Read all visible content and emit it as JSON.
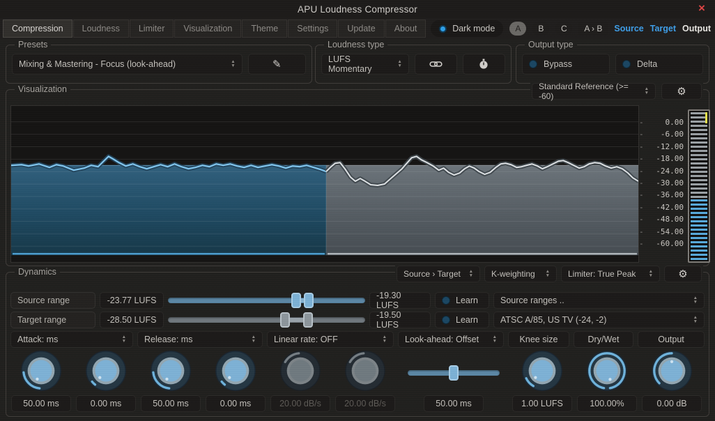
{
  "window": {
    "title": "APU Loudness Compressor"
  },
  "icons": {
    "close": "×",
    "edit": "✎",
    "gear": "⚙"
  },
  "tabs": [
    {
      "label": "Compression",
      "active": true
    },
    {
      "label": "Loudness"
    },
    {
      "label": "Limiter"
    },
    {
      "label": "Visualization"
    },
    {
      "label": "Theme"
    },
    {
      "label": "Settings"
    },
    {
      "label": "Update"
    },
    {
      "label": "About"
    }
  ],
  "topbar": {
    "dark_mode": "Dark mode",
    "variant_a": "A",
    "variant_b": "B",
    "variant_c": "C",
    "copy_ab": "A › B",
    "source": "Source",
    "target": "Target",
    "output": "Output"
  },
  "presets": {
    "legend": "Presets",
    "selected": "Mixing & Mastering - Focus (look-ahead)"
  },
  "loudness_type": {
    "legend": "Loudness type",
    "selected": "LUFS Momentary"
  },
  "output_type": {
    "legend": "Output type",
    "bypass": "Bypass",
    "delta": "Delta"
  },
  "visualization": {
    "legend": "Visualization",
    "reference": "Standard Reference (>= -60)",
    "scale_ticks": [
      "0.00",
      "-6.00",
      "-12.00",
      "-18.00",
      "-24.00",
      "-30.00",
      "-36.00",
      "-42.00",
      "-48.00",
      "-54.00",
      "-60.00"
    ]
  },
  "dynamics": {
    "legend": "Dynamics",
    "routing": "Source › Target",
    "weighting": "K-weighting",
    "limiter": "Limiter: True Peak",
    "source_range": {
      "label": "Source range",
      "low": "-23.77 LUFS",
      "high": "-19.30 LUFS",
      "learn": "Learn",
      "preset": "Source ranges .."
    },
    "target_range": {
      "label": "Target range",
      "low": "-28.50 LUFS",
      "high": "-19.50 LUFS",
      "learn": "Learn",
      "preset": "ATSC A/85, US TV (-24, -2)"
    },
    "param_headers": [
      {
        "label": "Attack: ms"
      },
      {
        "label": "Release: ms"
      },
      {
        "label": "Linear rate: OFF"
      },
      {
        "label": "Look-ahead: Offset"
      },
      {
        "label": "Knee size"
      },
      {
        "label": "Dry/Wet"
      },
      {
        "label": "Output"
      }
    ],
    "knobs": [
      {
        "id": "attack",
        "value": "50.00 ms"
      },
      {
        "id": "attack-secondary",
        "value": "0.00 ms"
      },
      {
        "id": "release",
        "value": "50.00 ms"
      },
      {
        "id": "release-secondary",
        "value": "0.00 ms"
      },
      {
        "id": "linear-rate-up",
        "value": "20.00 dB/s",
        "disabled": true
      },
      {
        "id": "linear-rate-down",
        "value": "20.00 dB/s",
        "disabled": true
      },
      {
        "id": "look-ahead",
        "value": "50.00 ms"
      },
      {
        "id": "knee-size",
        "value": "1.00 LUFS"
      },
      {
        "id": "dry-wet",
        "value": "100.00%"
      },
      {
        "id": "output-gain",
        "value": "0.00 dB"
      }
    ]
  },
  "colors": {
    "accent_blue": "#4da3e0",
    "meter_blue": "#58aadc",
    "meter_gray": "#9aa0a4",
    "peak_yellow": "#e6e14c",
    "close_red": "#e04545"
  }
}
